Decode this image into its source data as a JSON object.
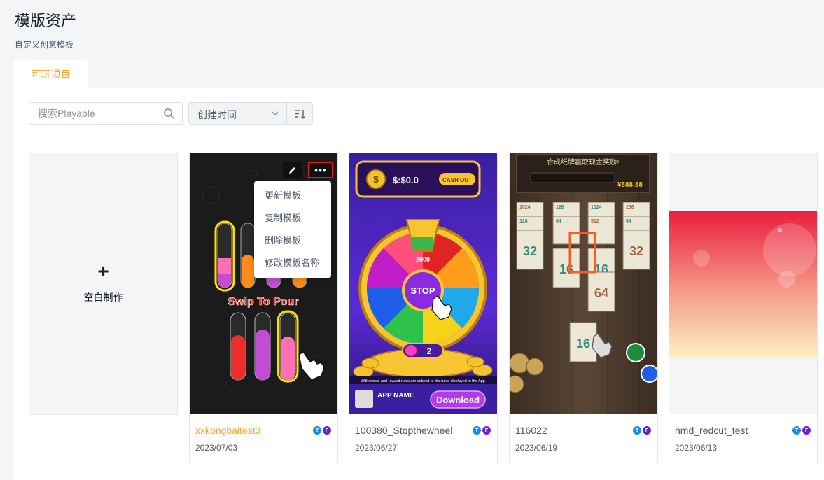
{
  "header": {
    "title": "模版资产",
    "subtitle": "自定义创意模板"
  },
  "tabs": [
    {
      "label": "可玩项目",
      "active": true
    }
  ],
  "toolbar": {
    "search_placeholder": "搜索Playable",
    "search_icon": "search-icon",
    "sort_value": "创建时间",
    "sort_chevron_icon": "chevron-down-icon",
    "sort_order_icon": "sort-order-icon"
  },
  "blank_card": {
    "plus": "+",
    "label": "空白制作"
  },
  "cards": [
    {
      "name": "xxkongbaitest3",
      "date": "2023/07/03",
      "highlighted": true,
      "platforms": [
        "T",
        "F"
      ],
      "thumbnail": {
        "kind": "sort-tubes",
        "caption": "Swip To Pour",
        "tube_colors": [
          "#c44bd6",
          "#ff8a1e",
          "#c44bd6",
          "#ff8a1e",
          "#ee2d2d",
          "#c44bd6",
          "#ff6fb5"
        ]
      }
    },
    {
      "name": "100380_Stopthewheel",
      "date": "2023/06/27",
      "highlighted": false,
      "platforms": [
        "T",
        "F"
      ],
      "thumbnail": {
        "kind": "spin-wheel",
        "balance": "$:$0.0",
        "cashout": "CASH OUT",
        "prize": "2000",
        "center": "STOP",
        "spins": "2",
        "disclaimer": "Withdrawal and reward rules are subject to the rules displayed in the App",
        "app_name": "APP NAME",
        "download": "Download"
      }
    },
    {
      "name": "116022",
      "date": "2023/06/19",
      "highlighted": false,
      "platforms": [
        "T",
        "F"
      ],
      "thumbnail": {
        "kind": "card-merge",
        "banner": "合成纸牌赢取现金奖励!",
        "prize": "¥888.88",
        "card_values": [
          "1024",
          "128",
          "1024",
          "256",
          "128",
          "64",
          "512",
          "64",
          "32",
          "32",
          "16",
          "16",
          "64",
          "16"
        ]
      }
    },
    {
      "name": "hmd_redcut_test",
      "date": "2023/06/13",
      "highlighted": false,
      "platforms": [
        "T",
        "F"
      ],
      "thumbnail": {
        "kind": "gradient"
      }
    }
  ],
  "card_actions": {
    "edit_icon": "pencil-icon",
    "more_icon": "more-dots-icon",
    "more": "•••"
  },
  "context_menu": {
    "items": [
      "更新模板",
      "复制模板",
      "删除模板",
      "修改模板名称"
    ]
  }
}
